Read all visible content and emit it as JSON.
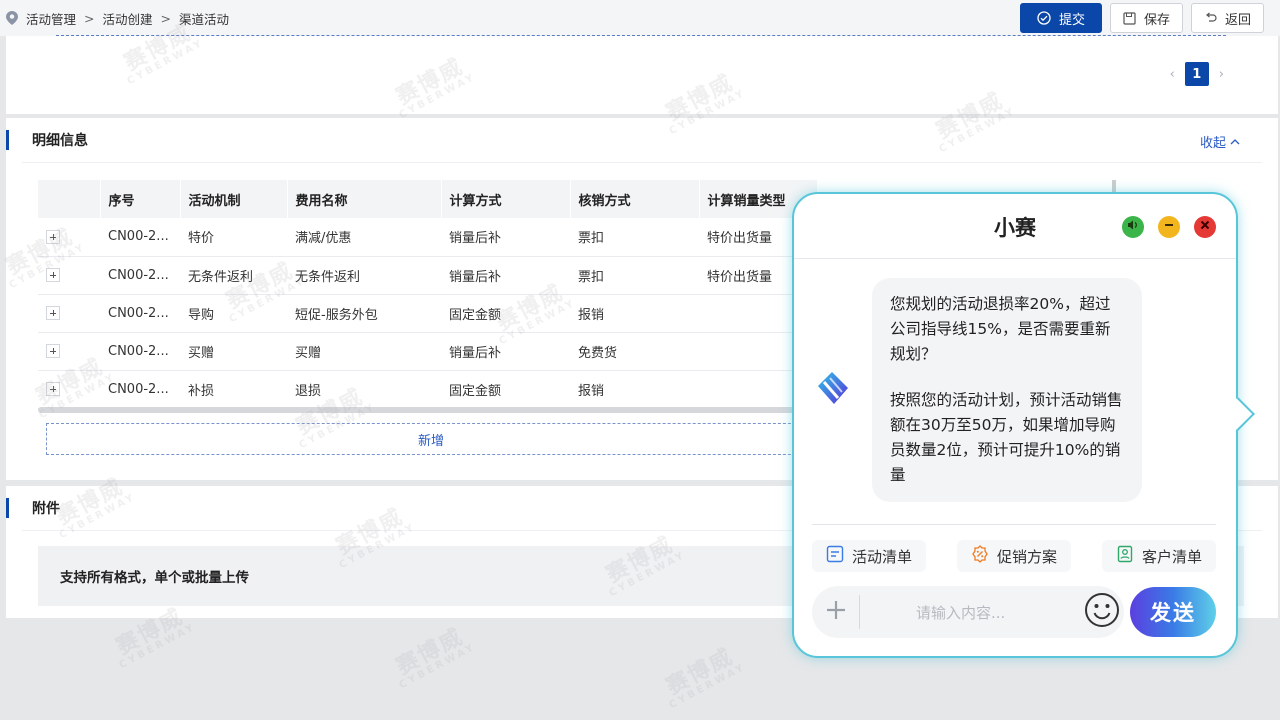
{
  "breadcrumb": [
    "活动管理",
    "活动创建",
    "渠道活动"
  ],
  "breadcrumb_sep": ">",
  "toolbar": {
    "submit": "提交",
    "save": "保存",
    "back": "返回"
  },
  "pagination": {
    "current": "1"
  },
  "detail": {
    "title": "明细信息",
    "collapse": "收起",
    "columns": [
      "",
      "序号",
      "活动机制",
      "费用名称",
      "计算方式",
      "核销方式",
      "计算销量类型"
    ],
    "rows": [
      [
        "CN00-2...",
        "特价",
        "满减/优惠",
        "销量后补",
        "票扣",
        "特价出货量"
      ],
      [
        "CN00-2...",
        "无条件返利",
        "无条件返利",
        "销量后补",
        "票扣",
        "特价出货量"
      ],
      [
        "CN00-2...",
        "导购",
        "短促-服务外包",
        "固定金额",
        "报销",
        ""
      ],
      [
        "CN00-2...",
        "买赠",
        "买赠",
        "销量后补",
        "免费货",
        ""
      ],
      [
        "CN00-2...",
        "补损",
        "退损",
        "固定金额",
        "报销",
        ""
      ]
    ],
    "add_label": "新增"
  },
  "attachment": {
    "title": "附件",
    "upload_text": "支持所有格式，单个或批量上传"
  },
  "chat": {
    "title": "小赛",
    "message_1": "您规划的活动退损率20%，超过公司指导线15%，是否需要重新规划？",
    "message_2": "按照您的活动计划，预计活动销售额在30万至50万，如果增加导购员数量2位，预计可提升10%的销量",
    "chips": [
      "活动清单",
      "促销方案",
      "客户清单"
    ],
    "input_placeholder": "请输入内容...",
    "send": "发送"
  },
  "watermark": {
    "cn": "赛博威",
    "en": "CYBERWAY"
  },
  "colors": {
    "primary": "#0b47a8",
    "chat_border": "#58c6d8",
    "link": "#2a5bc2"
  }
}
